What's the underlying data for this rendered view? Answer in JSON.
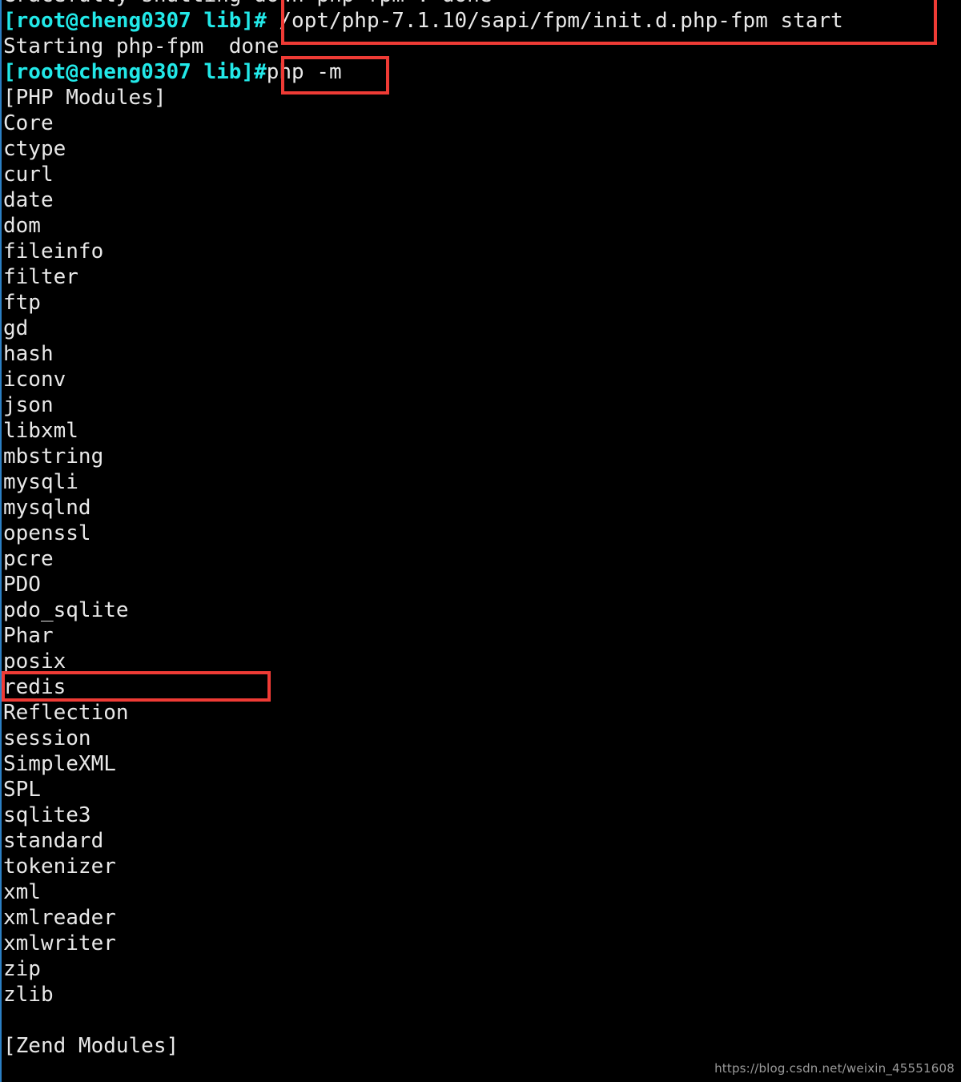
{
  "terminal": {
    "colors": {
      "background": "#000000",
      "foreground": "#e8e8e8",
      "prompt": "#22e8e8",
      "highlight_box": "#ef3b35",
      "edge_strip": "#2b7fc4",
      "watermark": "#9a9a9a"
    },
    "prompt_text": "[root@cheng0307 lib]#",
    "scrollback_top_partial": "Gracefully shutting down php-fpm . done",
    "lines": [
      {
        "type": "output",
        "text": "Gracefully shutting down php-fpm . done"
      },
      {
        "type": "command",
        "prompt": "[root@cheng0307 lib]#",
        "text": " /opt/php-7.1.10/sapi/fpm/init.d.php-fpm start"
      },
      {
        "type": "output",
        "text": "Starting php-fpm  done"
      },
      {
        "type": "command",
        "prompt": "[root@cheng0307 lib]#",
        "text": "php -m"
      }
    ],
    "php_modules_header": "[PHP Modules]",
    "php_modules": [
      "Core",
      "ctype",
      "curl",
      "date",
      "dom",
      "fileinfo",
      "filter",
      "ftp",
      "gd",
      "hash",
      "iconv",
      "json",
      "libxml",
      "mbstring",
      "mysqli",
      "mysqlnd",
      "openssl",
      "pcre",
      "PDO",
      "pdo_sqlite",
      "Phar",
      "posix",
      "redis",
      "Reflection",
      "session",
      "SimpleXML",
      "SPL",
      "sqlite3",
      "standard",
      "tokenizer",
      "xml",
      "xmlreader",
      "xmlwriter",
      "zip",
      "zlib"
    ],
    "zend_modules_header": "[Zend Modules]",
    "zend_modules": [],
    "highlights": [
      {
        "name": "start-command",
        "target": "/opt/php-7.1.10/sapi/fpm/init.d.php-fpm start"
      },
      {
        "name": "php-m-command",
        "target": "php -m"
      },
      {
        "name": "redis-module",
        "target": "redis"
      }
    ],
    "watermark": "https://blog.csdn.net/weixin_45551608"
  }
}
